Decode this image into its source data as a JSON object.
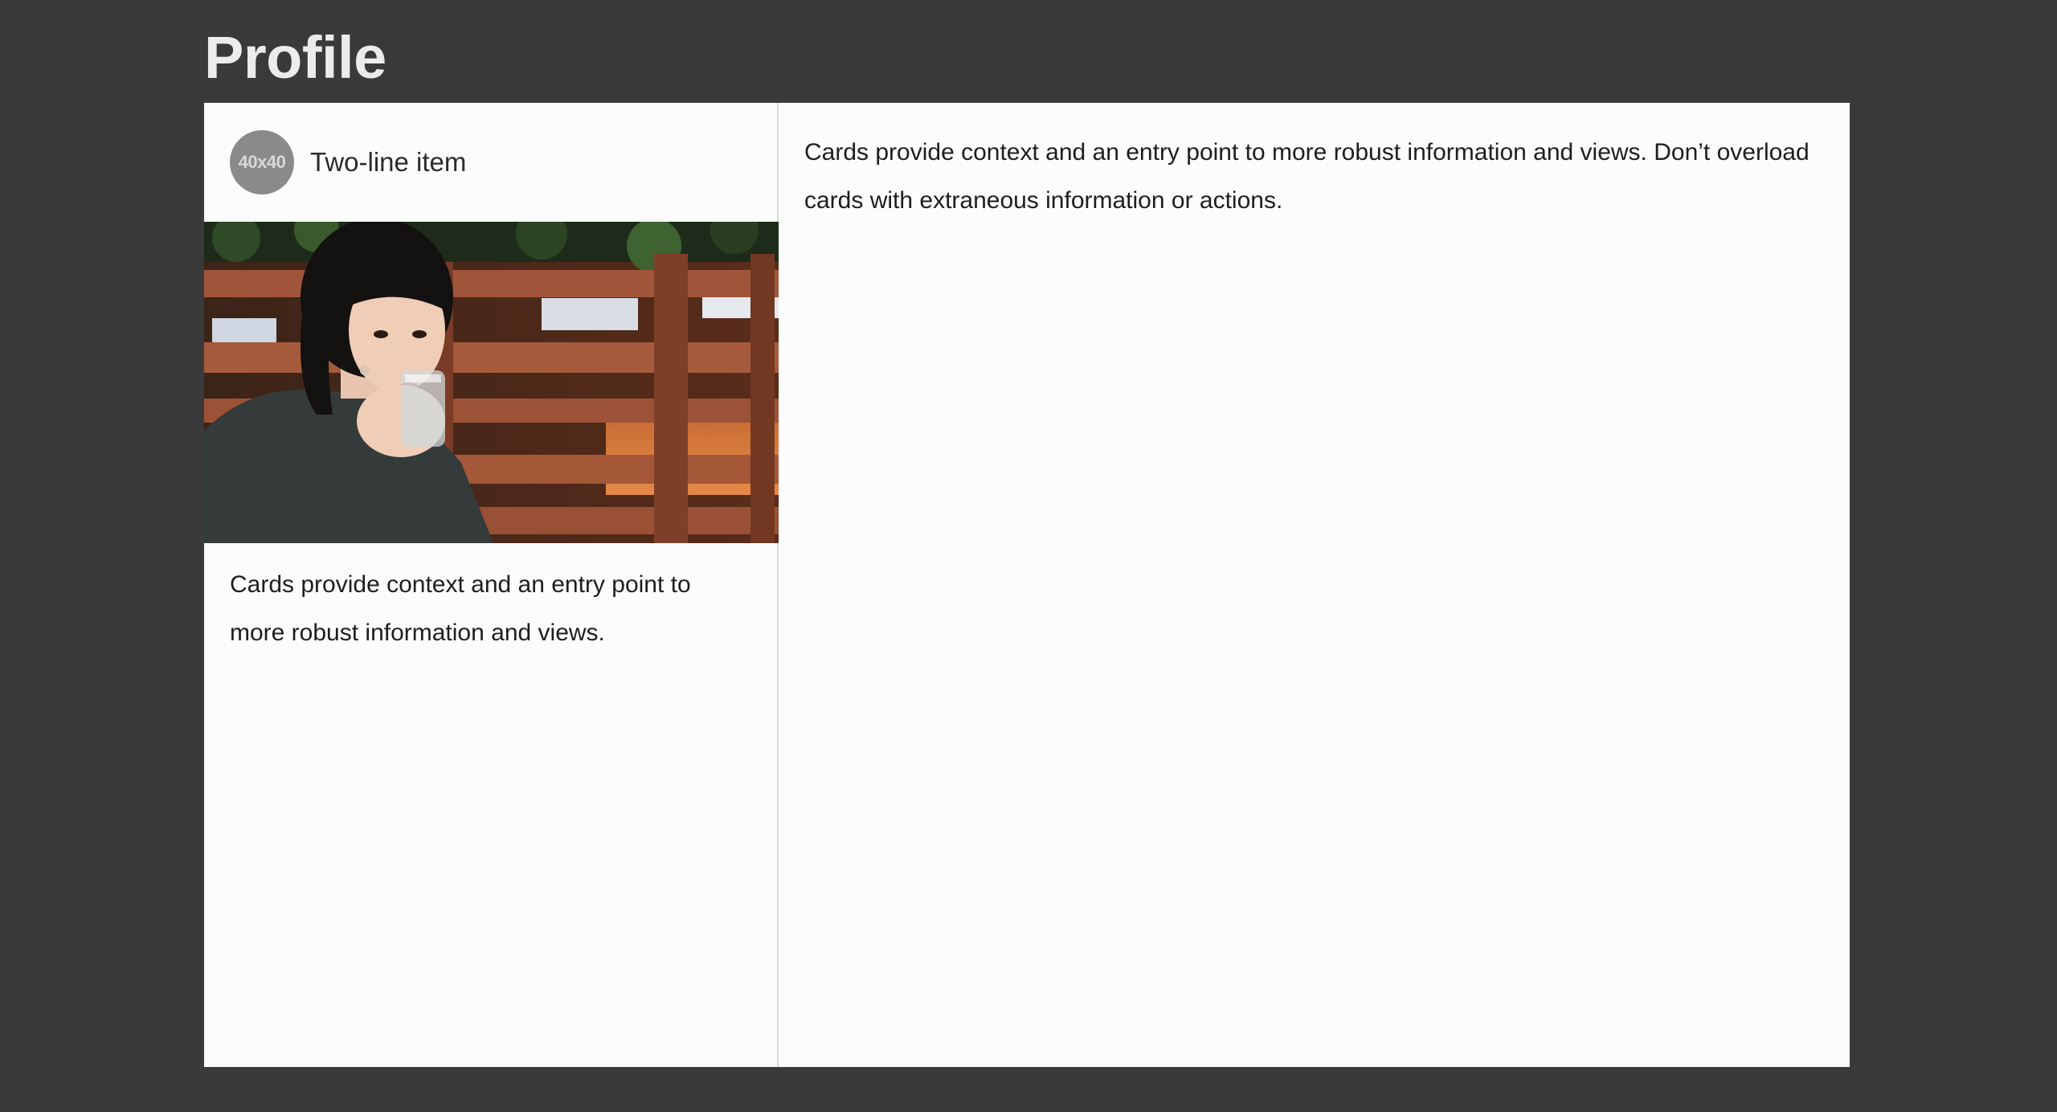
{
  "page": {
    "title": "Profile"
  },
  "cards": {
    "left": {
      "avatar_text": "40x40",
      "item_label": "Two-line item",
      "image_alt": "Woman drinking from a glass in front of a wooden slatted fence",
      "supporting_text": "Cards provide context and an entry point to more robust information and views."
    },
    "right": {
      "supporting_text": "Cards provide context and an entry point to more robust information and views. Don’t overload cards with extraneous information or actions."
    }
  },
  "colors": {
    "background": "#3a3a3a",
    "card": "#fcfcfc",
    "title": "#ececec",
    "avatar": "#8a8a8a",
    "text": "#1e1e1e"
  }
}
